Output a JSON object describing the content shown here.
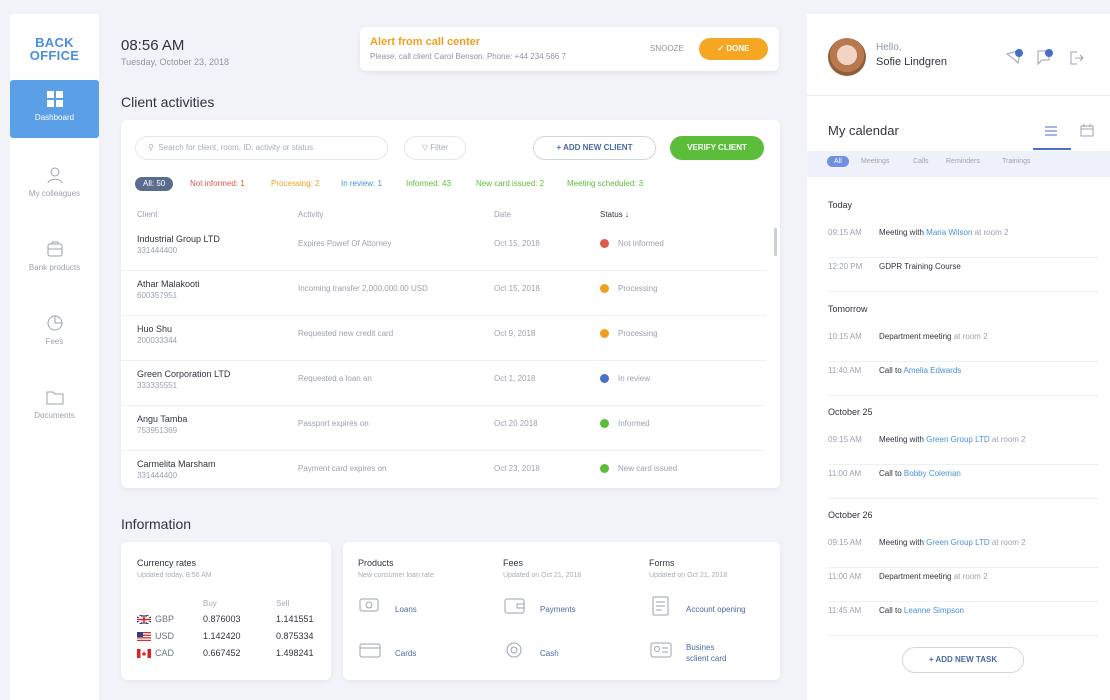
{
  "logo": {
    "line1": "BACK",
    "line2": "OFFICE"
  },
  "nav": [
    {
      "label": "Dashboard",
      "icon": "grid-icon"
    },
    {
      "label": "My colleagues",
      "icon": "people-icon"
    },
    {
      "label": "Bank products",
      "icon": "box-icon"
    },
    {
      "label": "Fees",
      "icon": "pie-icon"
    },
    {
      "label": "Documents",
      "icon": "folder-icon"
    }
  ],
  "header": {
    "time": "08:56 AM",
    "date": "Tuesday, October 23, 2018"
  },
  "alert": {
    "title": "Alert from call center",
    "text": "Please, call client Carol Benson. Phone: +44 234 566 7",
    "snooze": "SNOOZE",
    "done": "✓ DONE"
  },
  "activities": {
    "title": "Client activities",
    "search_placeholder": "Search for client, room, ID, activity or status",
    "filter": "Filter",
    "add_client": "+ ADD NEW CLIENT",
    "verify_client": "VERIFY CLIENT",
    "chips": [
      {
        "label": "All: 50",
        "color": "#5b6d8e"
      },
      {
        "label": "Not informed: 1",
        "color": "#e0584d"
      },
      {
        "label": "Processing: 2",
        "color": "#f0a020"
      },
      {
        "label": "In review: 1",
        "color": "#4a90d9"
      },
      {
        "label": "Informed: 43",
        "color": "#5cbd3b"
      },
      {
        "label": "New card issued: 2",
        "color": "#5cbd3b"
      },
      {
        "label": "Meeting scheduled: 3",
        "color": "#5cbd3b"
      }
    ],
    "columns": [
      "Client",
      "Activity",
      "Date",
      "Status ↓"
    ],
    "rows": [
      {
        "name": "Industrial Group LTD",
        "id": "331444400",
        "activity": "Expires Powef Of Attorney",
        "date": "Oct 15, 2018",
        "status": "Not informed",
        "color": "#e0584d"
      },
      {
        "name": "Athar Malakooti",
        "id": "600357951",
        "activity": "Incoming transfer 2,000,000.00 USD",
        "date": "Oct 15, 2018",
        "status": "Processing",
        "color": "#f0a020"
      },
      {
        "name": "Huo Shu",
        "id": "200033344",
        "activity": "Requested new credit card",
        "date": "Oct 9, 2018",
        "status": "Processing",
        "color": "#f0a020"
      },
      {
        "name": "Green Corporation LTD",
        "id": "333335551",
        "activity": "Requested a loan an",
        "date": "Oct 1, 2018",
        "status": "In review",
        "color": "#4a6fc9"
      },
      {
        "name": "Angu Tamba",
        "id": "753951369",
        "activity": "Passport expires on",
        "date": "Oct 20 2018",
        "status": "Informed",
        "color": "#5cbd3b"
      },
      {
        "name": "Carmelita Marsham",
        "id": "331444400",
        "activity": "Payment card expires on",
        "date": "Oct 23, 2018",
        "status": "New card issued",
        "color": "#5cbd3b"
      }
    ]
  },
  "information": {
    "title": "Information",
    "currency": {
      "title": "Currency rates",
      "updated": "Updated today, 8:56 AM",
      "buy": "Buy",
      "sell": "Sell",
      "rows": [
        {
          "code": "GBP",
          "buy": "0.876003",
          "sell": "1.141551"
        },
        {
          "code": "USD",
          "buy": "1.142420",
          "sell": "0.875334"
        },
        {
          "code": "CAD",
          "buy": "0.667452",
          "sell": "1.498241"
        }
      ]
    },
    "products": {
      "title": "Products",
      "sub": "New consumer loan rate",
      "items": [
        "Loans",
        "Cards"
      ]
    },
    "fees": {
      "title": "Fees",
      "sub": "Updated on Oct 21, 2018",
      "items": [
        "Payments",
        "Cash"
      ]
    },
    "forms": {
      "title": "Forms",
      "sub": "Updated on Oct 21, 2018",
      "items": [
        "Account opening",
        "Busines",
        "sclient card"
      ]
    }
  },
  "user": {
    "hello": "Hello,",
    "name": "Sofie Lindgren"
  },
  "calendar": {
    "title": "My calendar",
    "tabs": [
      "All",
      "Meetings",
      "Calls",
      "Reminders",
      "Trainings"
    ],
    "groups": [
      {
        "date": "Today",
        "events": [
          {
            "time": "09:15 AM",
            "main": "Meeting with",
            "link": "Maria Wilson",
            "tail": "at room 2"
          },
          {
            "time": "12:20 PM",
            "main": "GDPR Training Course",
            "link": "",
            "tail": ""
          }
        ]
      },
      {
        "date": "Tomorrow",
        "events": [
          {
            "time": "10:15 AM",
            "main": "Department meeting",
            "link": "",
            "tail": "at room 2"
          },
          {
            "time": "11:40 AM",
            "main": "Call to",
            "link": "Amelia Edwards",
            "tail": ""
          }
        ]
      },
      {
        "date": "October 25",
        "events": [
          {
            "time": "09:15 AM",
            "main": "Meeting with",
            "link": "Green Group LTD",
            "tail": "at room 2"
          },
          {
            "time": "11:00 AM",
            "main": "Call to",
            "link": "Bobby Coleman",
            "tail": ""
          }
        ]
      },
      {
        "date": "October 26",
        "events": [
          {
            "time": "09:15 AM",
            "main": "Meeting with",
            "link": "Green Group LTD",
            "tail": "at room 2"
          },
          {
            "time": "11:00 AM",
            "main": "Department meeting",
            "link": "",
            "tail": "at room 2"
          },
          {
            "time": "11:45 AM",
            "main": "Call to",
            "link": "Leanne Simpson",
            "tail": ""
          }
        ]
      }
    ],
    "add_task": "+ ADD NEW TASK"
  }
}
